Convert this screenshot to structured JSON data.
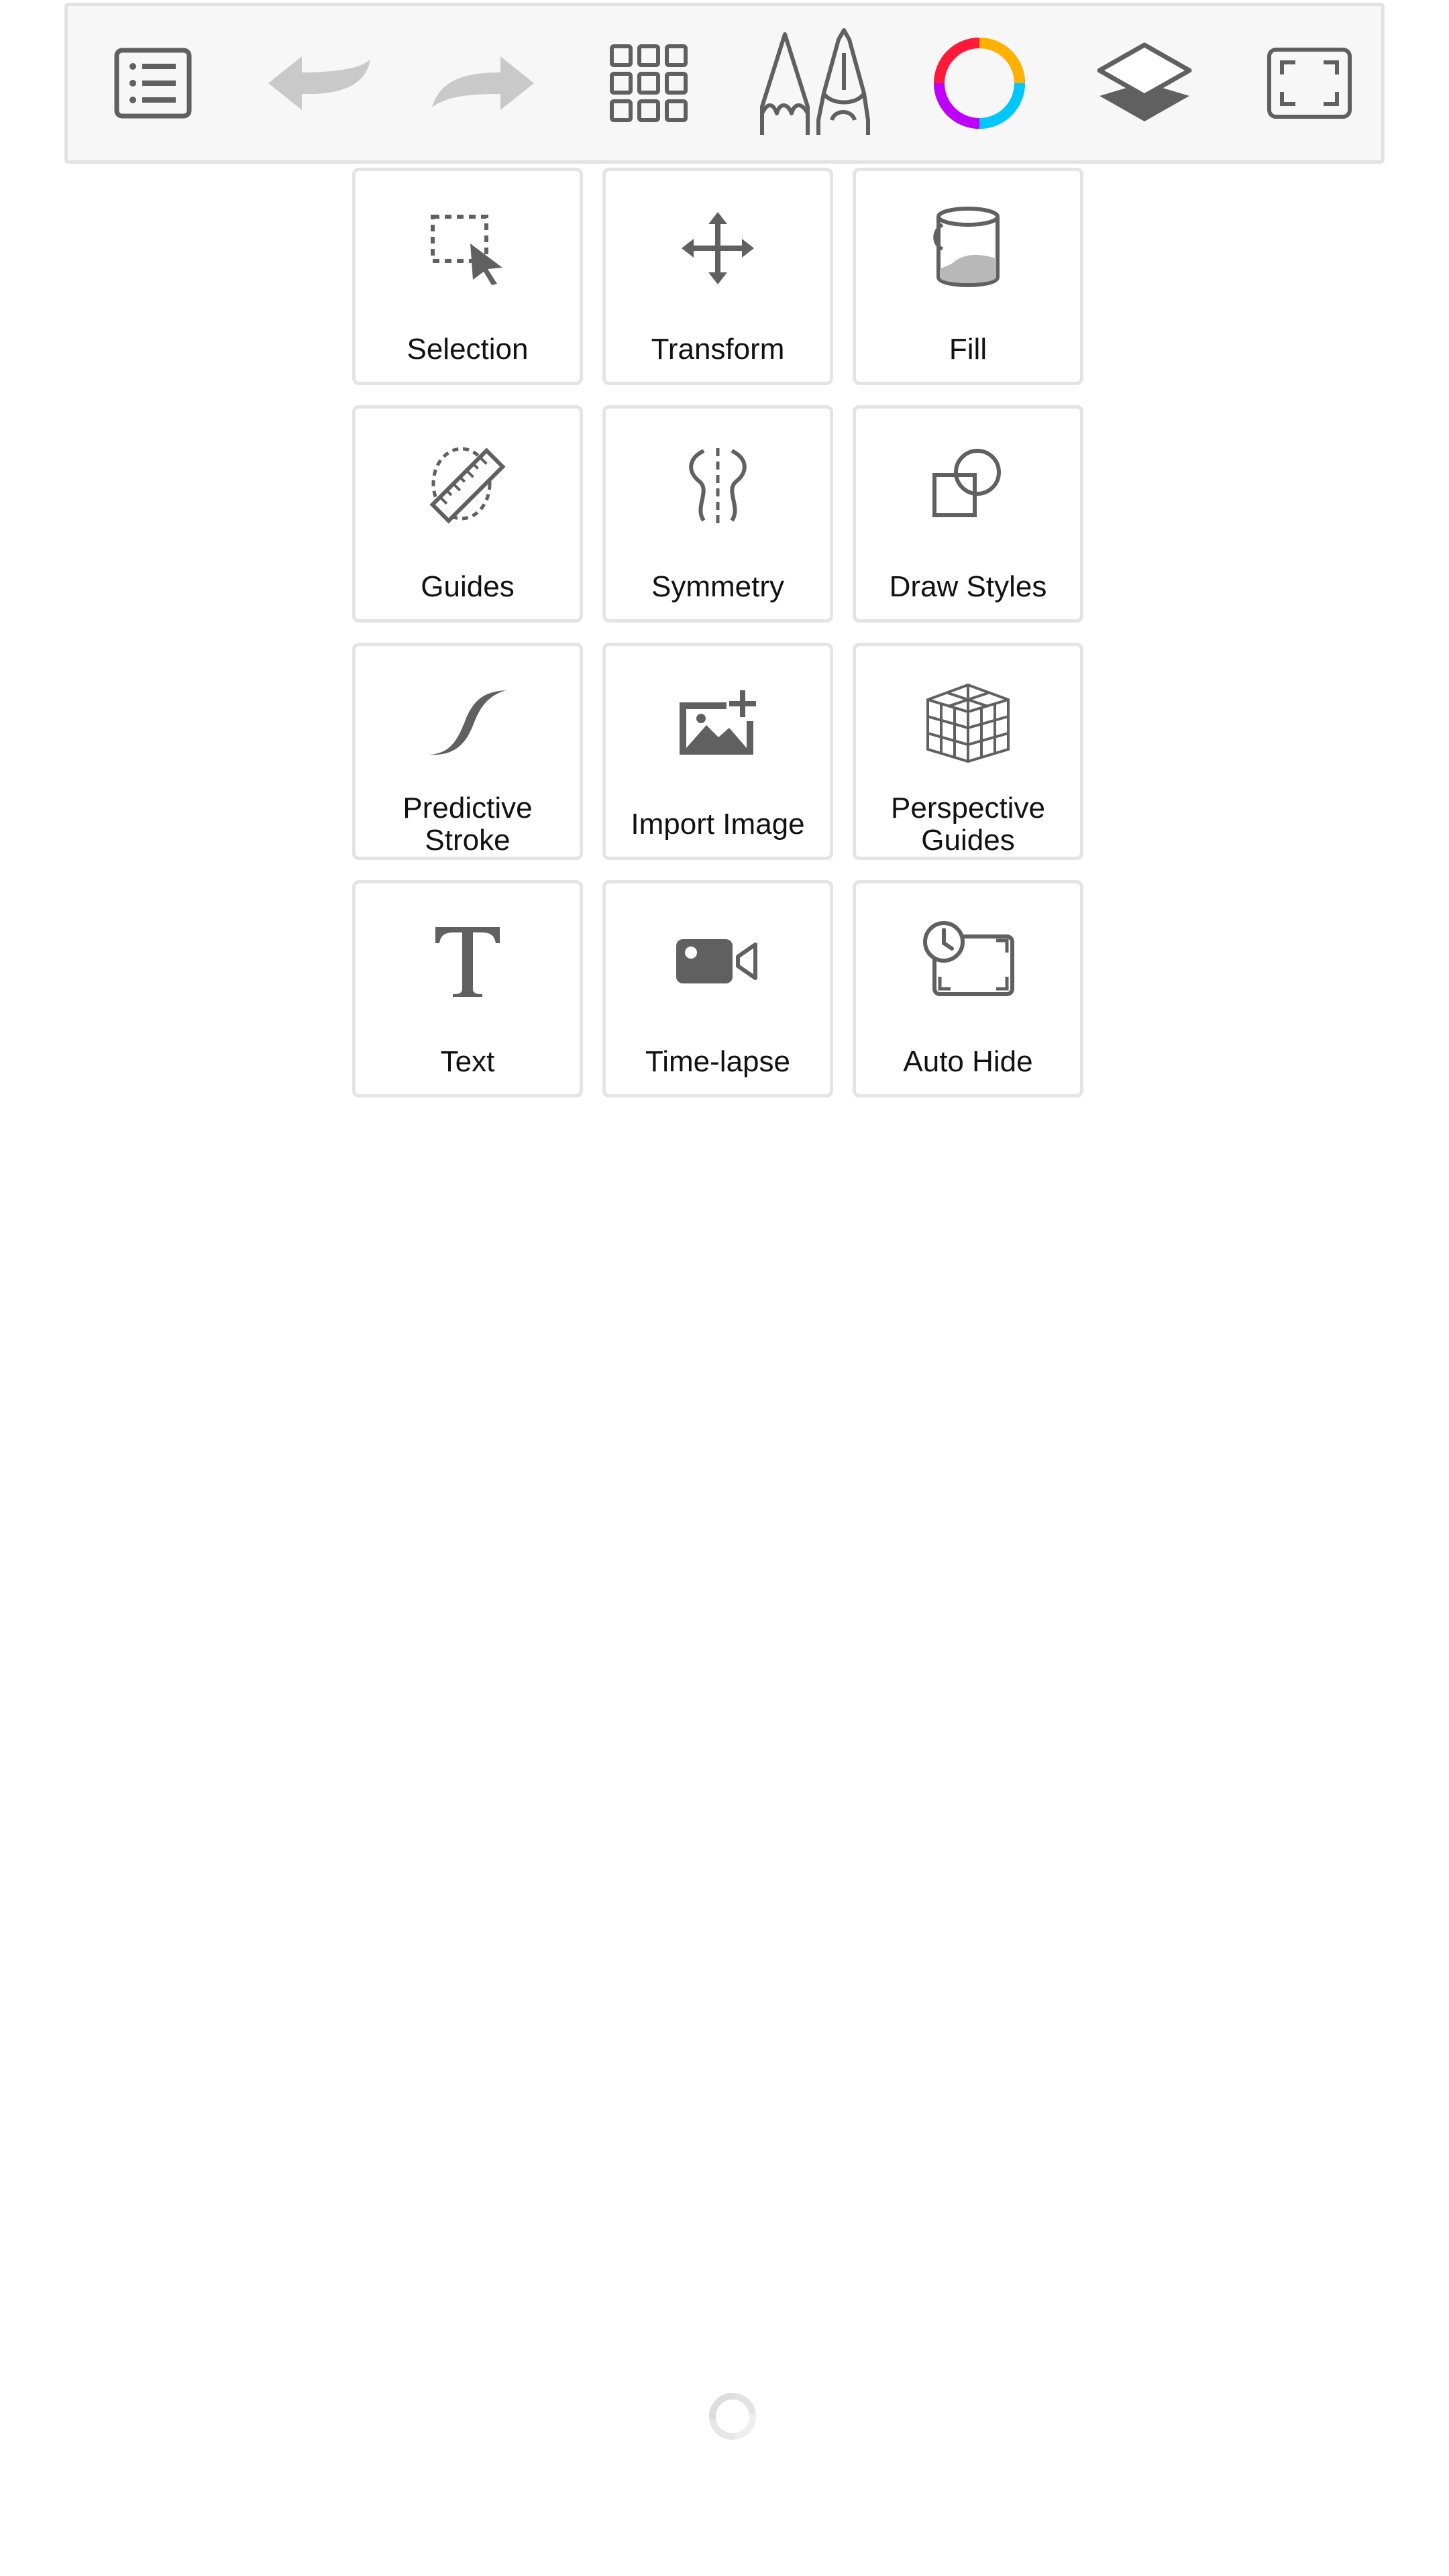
{
  "toolbar": {
    "buttons": [
      {
        "name": "menu-list",
        "icon": "list-icon"
      },
      {
        "name": "undo",
        "icon": "undo-arrow-icon"
      },
      {
        "name": "redo",
        "icon": "redo-arrow-icon"
      },
      {
        "name": "tools-grid",
        "icon": "grid-icon"
      },
      {
        "name": "brushes",
        "icon": "pencil-pen-icon"
      },
      {
        "name": "color",
        "icon": "color-wheel-icon"
      },
      {
        "name": "layers",
        "icon": "layers-icon"
      },
      {
        "name": "fullscreen",
        "icon": "fullscreen-icon"
      }
    ]
  },
  "tools": [
    {
      "label": "Selection",
      "icon": "selection-icon"
    },
    {
      "label": "Transform",
      "icon": "transform-move-icon"
    },
    {
      "label": "Fill",
      "icon": "paint-bucket-icon"
    },
    {
      "label": "Guides",
      "icon": "ruler-guide-icon"
    },
    {
      "label": "Symmetry",
      "icon": "symmetry-icon"
    },
    {
      "label": "Draw Styles",
      "icon": "shapes-icon"
    },
    {
      "label": "Predictive\nStroke",
      "icon": "stroke-curve-icon"
    },
    {
      "label": "Import Image",
      "icon": "image-add-icon"
    },
    {
      "label": "Perspective\nGuides",
      "icon": "perspective-grid-icon"
    },
    {
      "label": "Text",
      "icon": "text-t-icon"
    },
    {
      "label": "Time-lapse",
      "icon": "video-camera-icon"
    },
    {
      "label": "Auto Hide",
      "icon": "auto-hide-clock-icon"
    }
  ],
  "colors": {
    "icon": "#606060",
    "icon_disabled": "#c9c9c9",
    "tile_border": "#e4e4e4",
    "toolbar_bg": "#f7f7f7"
  }
}
